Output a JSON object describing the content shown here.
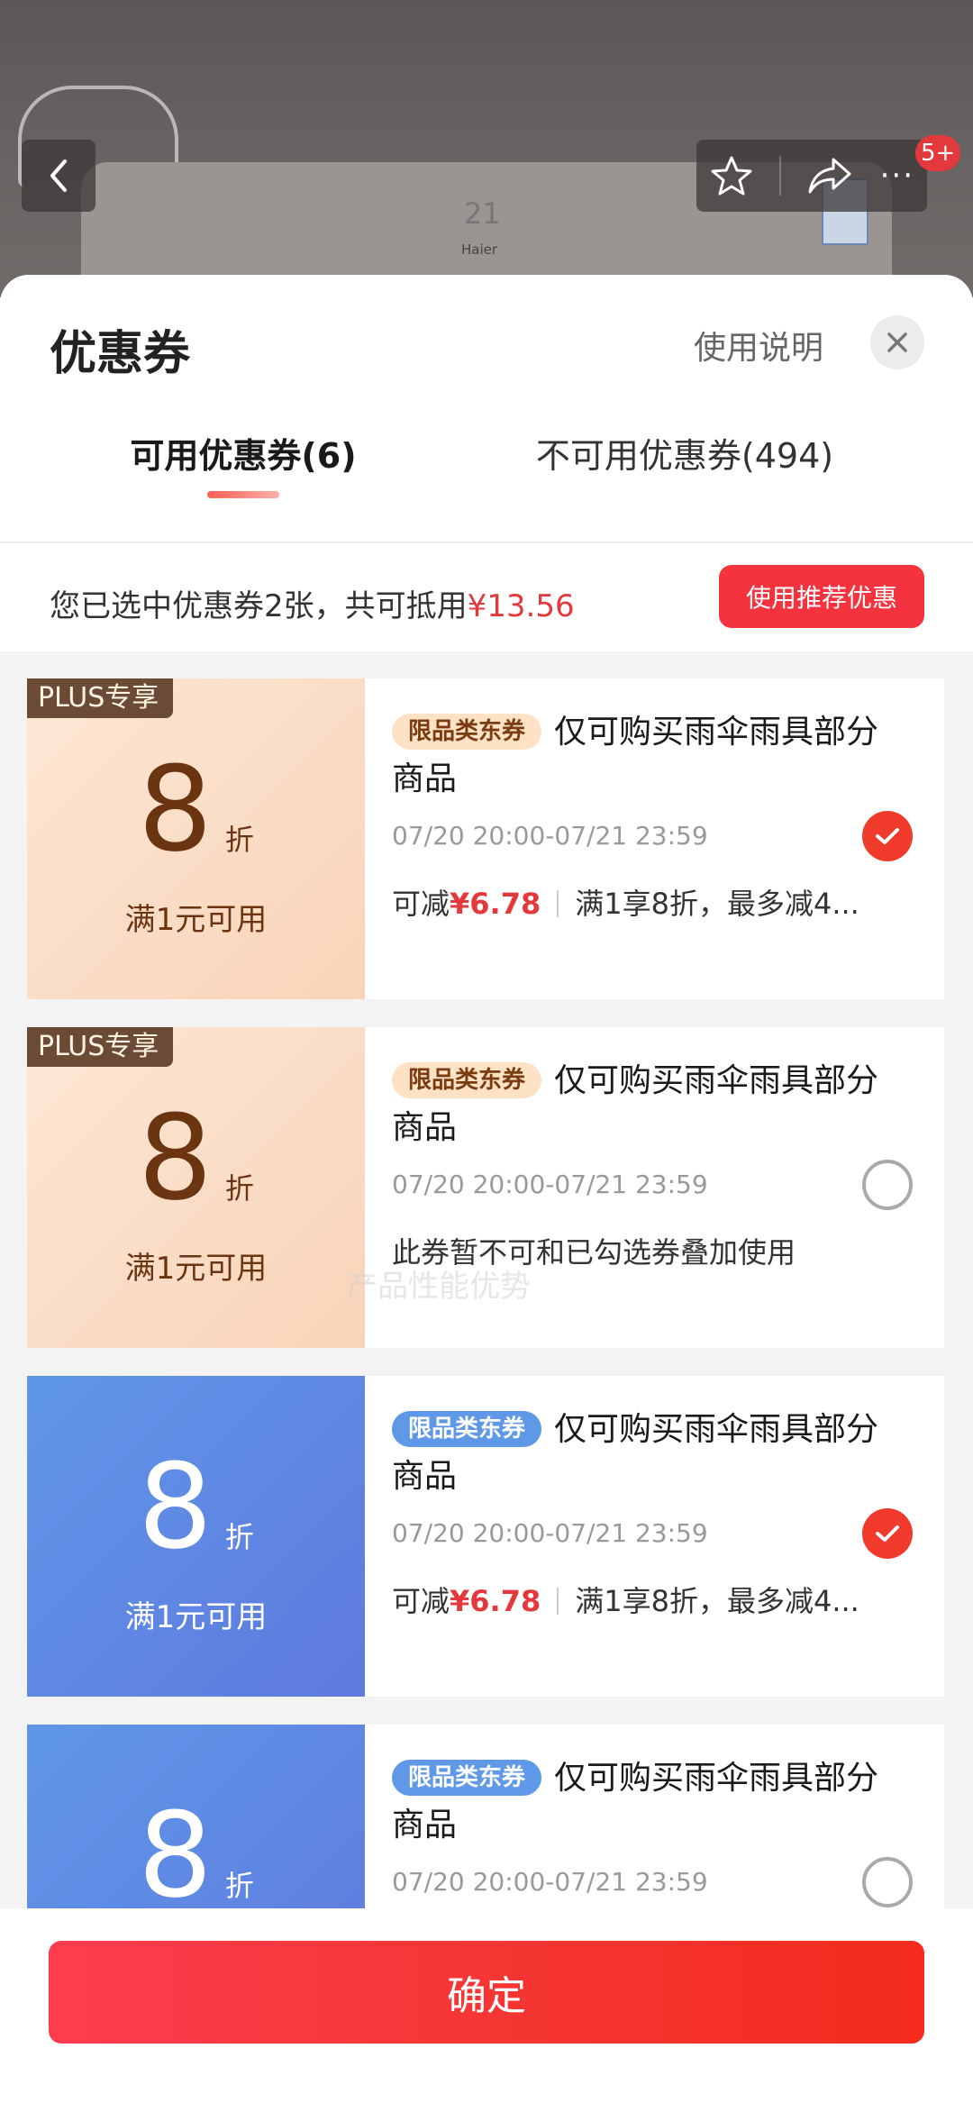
{
  "header": {
    "badge": "5+",
    "product_logo": "Haier",
    "product_digit": "21"
  },
  "sheet": {
    "title": "优惠券",
    "help_label": "使用说明"
  },
  "tabs": [
    {
      "label": "可用优惠券(6)",
      "active": true
    },
    {
      "label": "不可用优惠券(494)",
      "active": false
    }
  ],
  "summary": {
    "text": "您已选中优惠券2张，共可抵用",
    "amount": "¥13.56",
    "recommend_label": "使用推荐优惠"
  },
  "coupons": [
    {
      "plus_tag": "PLUS专享",
      "value": "8",
      "unit": "折",
      "threshold": "满1元可用",
      "category": "限品类东券",
      "title": "仅可购买雨伞雨具部分商品",
      "date": "07/20 20:00-07/21 23:59",
      "saving_label": "可减",
      "saving_amount": "¥6.78",
      "rule": "满1享8折，最多减4...",
      "selected": true
    },
    {
      "plus_tag": "PLUS专享",
      "value": "8",
      "unit": "折",
      "threshold": "满1元可用",
      "category": "限品类东券",
      "title": "仅可购买雨伞雨具部分商品",
      "date": "07/20 20:00-07/21 23:59",
      "note": "此券暂不可和已勾选券叠加使用",
      "selected": false
    },
    {
      "value": "8",
      "unit": "折",
      "threshold": "满1元可用",
      "category": "限品类东券",
      "title": "仅可购买雨伞雨具部分商品",
      "date": "07/20 20:00-07/21 23:59",
      "saving_label": "可减",
      "saving_amount": "¥6.78",
      "rule": "满1享8折，最多减4...",
      "selected": true
    },
    {
      "value": "8",
      "unit": "折",
      "category": "限品类东券",
      "title": "仅可购买雨伞雨具部分商品",
      "date": "07/20 20:00-07/21 23:59",
      "selected": false
    }
  ],
  "watermark": "产品性能优势",
  "footer": {
    "confirm_label": "确定"
  },
  "colors": {
    "accent": "#e4393c",
    "check_on": "#ef3a2c",
    "plus_card": "#f8d3b8",
    "jd_card": "#5f87e2"
  },
  "icons": {
    "back": "chevron-left-icon",
    "favorite": "star-icon",
    "share": "share-arrow-icon",
    "more": "more-dots-icon",
    "close": "close-icon",
    "check": "check-icon"
  }
}
